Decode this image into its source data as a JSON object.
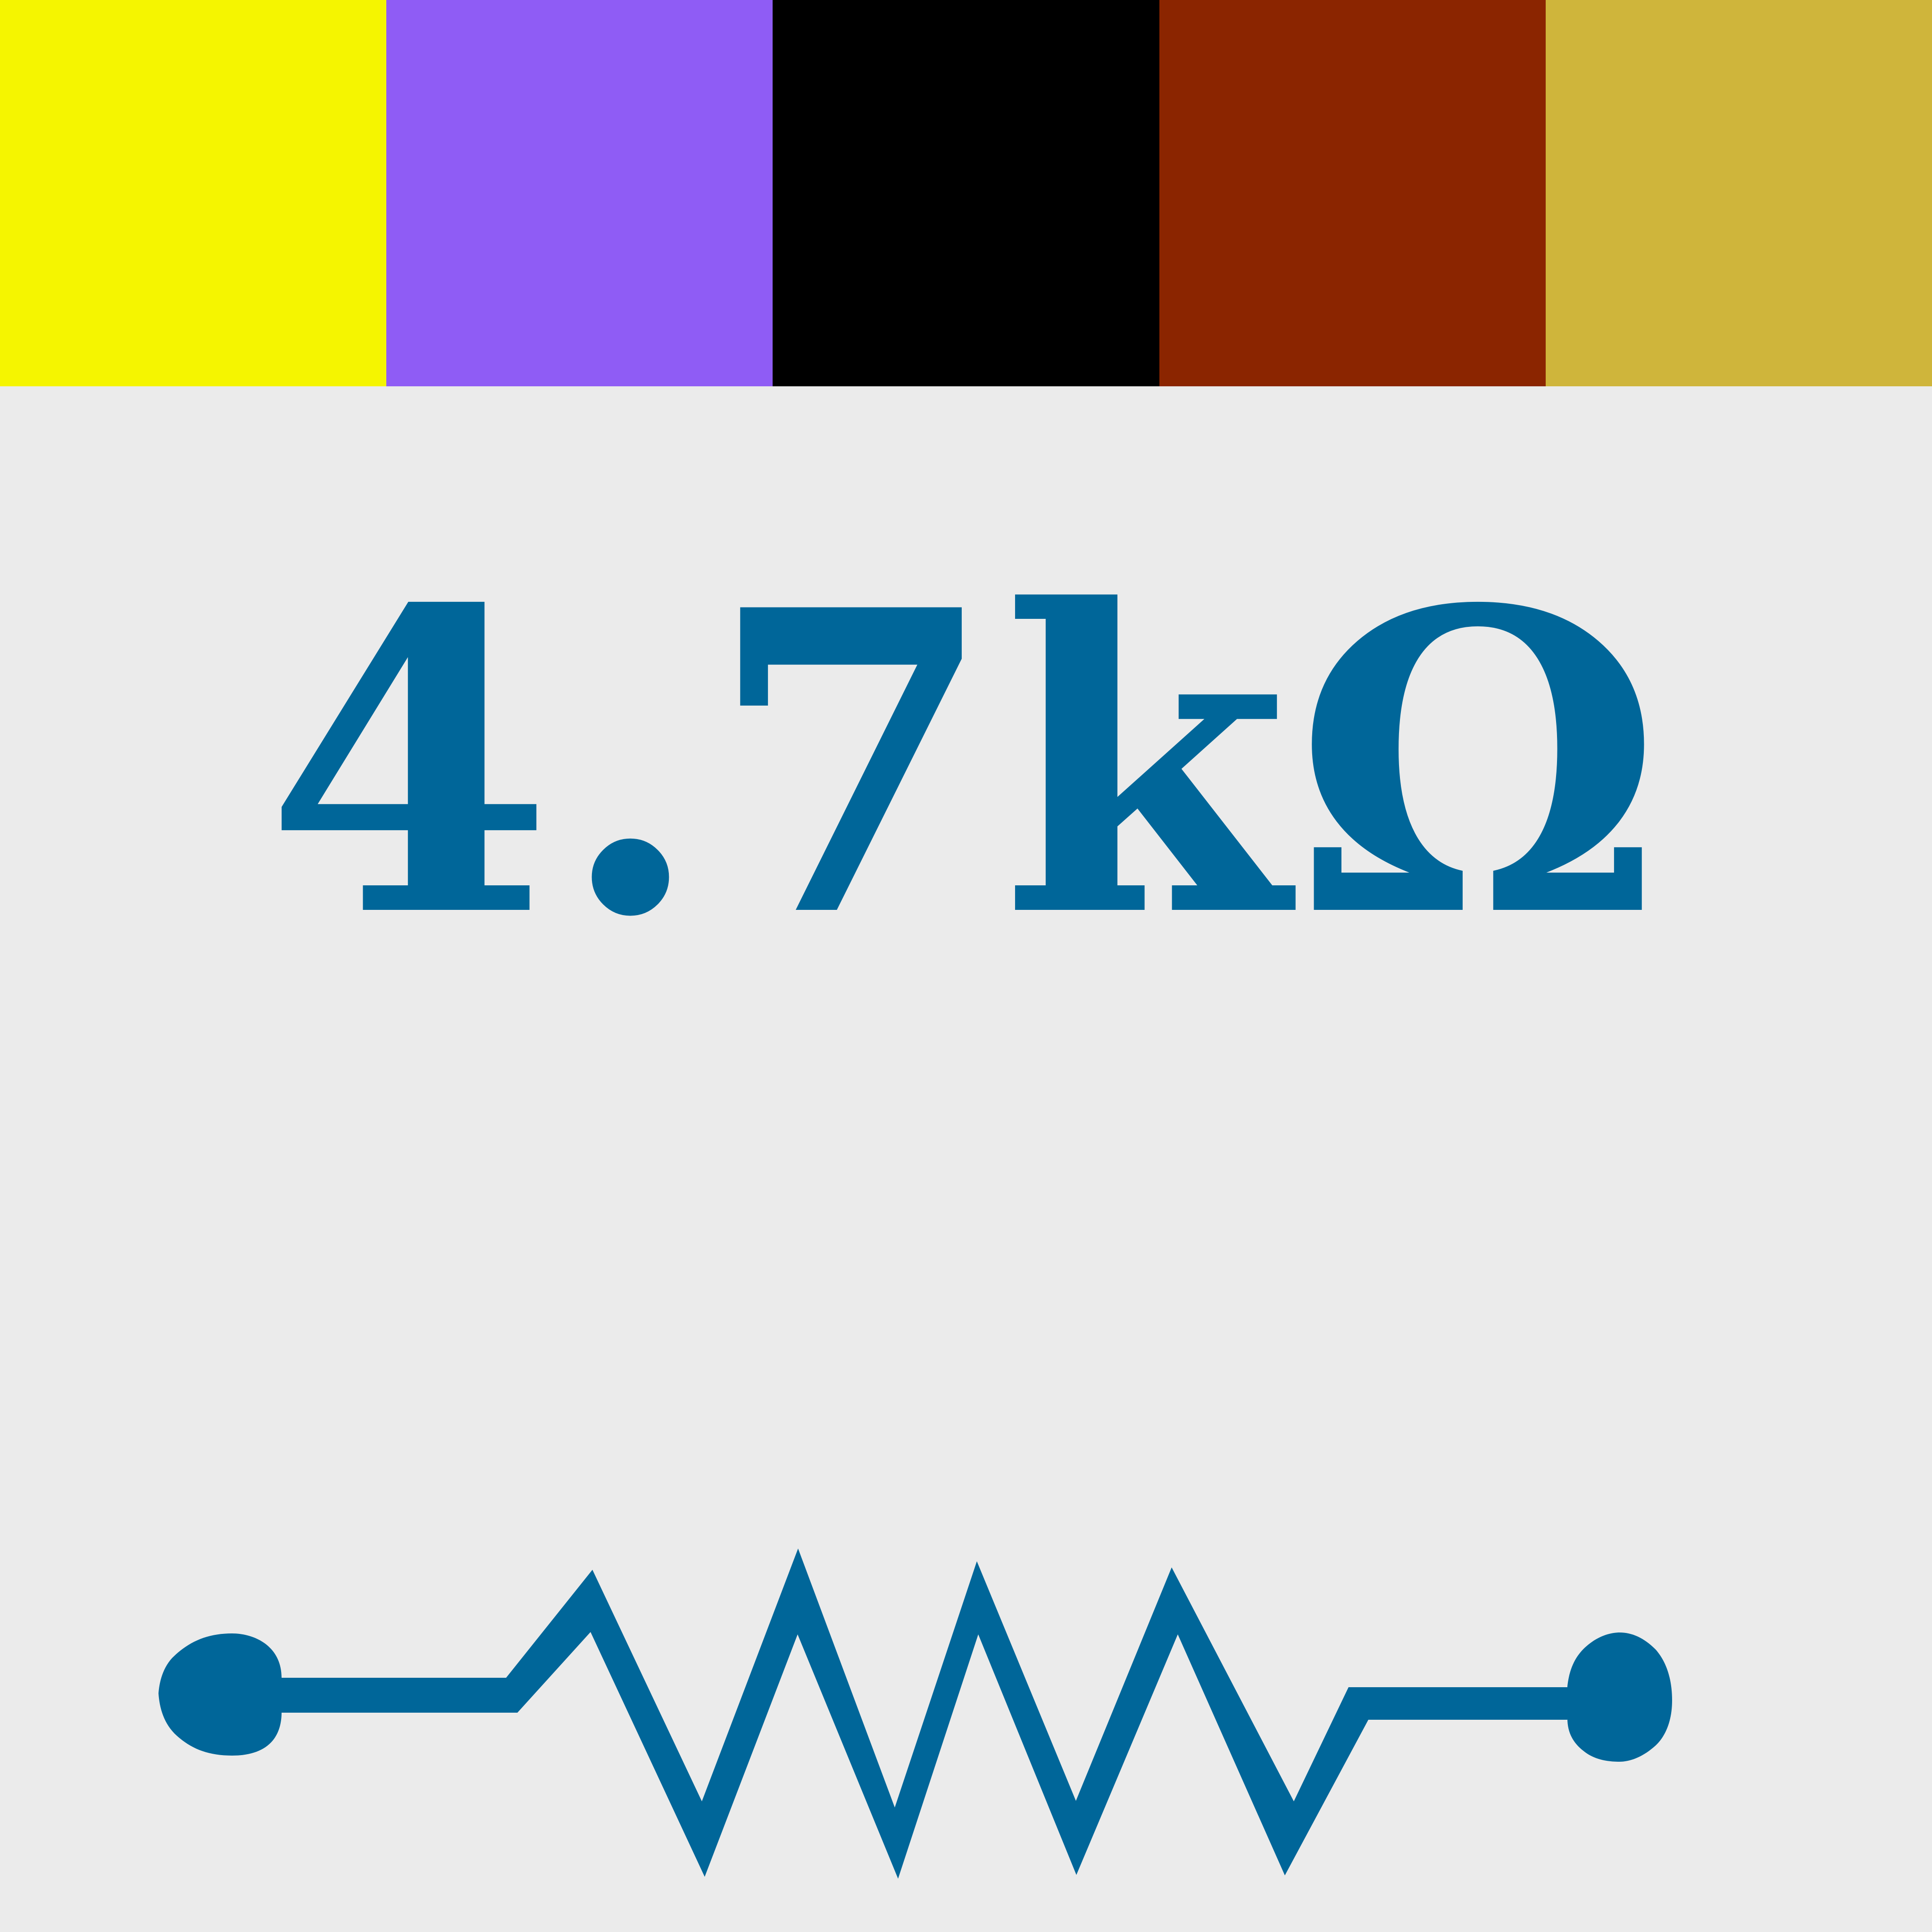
{
  "bands": [
    {
      "name": "band-1",
      "color": "#f5f500"
    },
    {
      "name": "band-2",
      "color": "#8f5cf5"
    },
    {
      "name": "band-3",
      "color": "#000000"
    },
    {
      "name": "band-4",
      "color": "#8b2500"
    },
    {
      "name": "band-5",
      "color": "#cfb53b"
    }
  ],
  "value": {
    "text": "4.7kΩ"
  },
  "colors": {
    "foreground": "#006699",
    "background": "#ebebeb"
  },
  "symbol": {
    "icon": "resistor-symbol-icon"
  }
}
